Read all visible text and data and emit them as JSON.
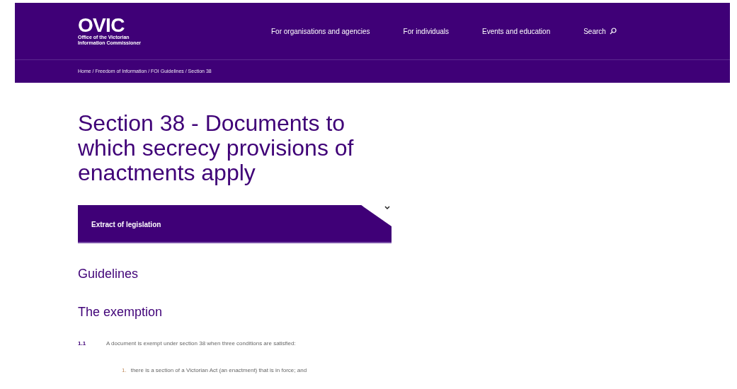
{
  "header": {
    "logo": {
      "wordmark": "OVIC",
      "subtitle_lines": [
        "Office of the Victorian",
        "Information Commissioner"
      ]
    },
    "nav": [
      {
        "label": "For organisations and agencies",
        "kind": "link"
      },
      {
        "label": "For individuals",
        "kind": "link"
      },
      {
        "label": "Events and education",
        "kind": "link"
      },
      {
        "label": "Search",
        "kind": "search"
      }
    ],
    "breadcrumb": "Home / Freedom of Information / FOI Guidelines / Section 38"
  },
  "page_title": "Section 38 - Documents to which secrecy provisions of enactments apply",
  "accordion": {
    "label": "Extract of legislation",
    "expanded": false
  },
  "headings": [
    "Guidelines",
    "The exemption"
  ],
  "paragraphs": [
    {
      "number": "1.1",
      "text": "A document is exempt under section 38 when three conditions are satisfied:"
    }
  ],
  "list_items": [
    {
      "number": "1.",
      "text": "there is a section of a Victorian Act (an enactment) that is in force; and"
    }
  ]
}
